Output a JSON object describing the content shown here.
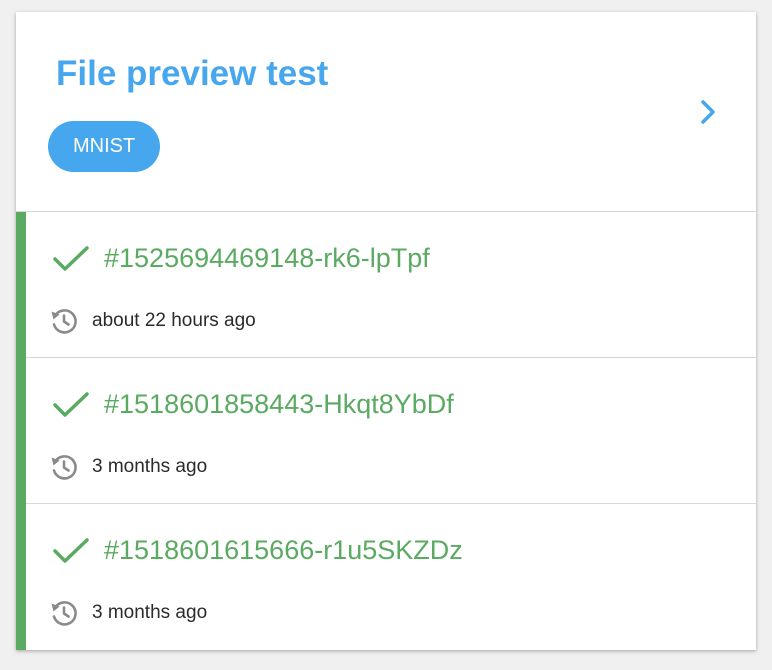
{
  "experiment": {
    "title": "File preview test",
    "tag": "MNIST"
  },
  "runs": [
    {
      "id": "#1525694469148-rk6-lpTpf",
      "status": "success",
      "time": "about 22 hours ago"
    },
    {
      "id": "#1518601858443-Hkqt8YbDf",
      "status": "success",
      "time": "3 months ago"
    },
    {
      "id": "#1518601615666-r1u5SKZDz",
      "status": "success",
      "time": "3 months ago"
    }
  ],
  "icons": {
    "open": "chevron-right-icon",
    "status": "check-icon",
    "time": "clock-history-icon"
  },
  "colors": {
    "accent_blue": "#46a6ee",
    "success_green": "#5aaa62",
    "icon_gray": "#8a8a8a"
  }
}
